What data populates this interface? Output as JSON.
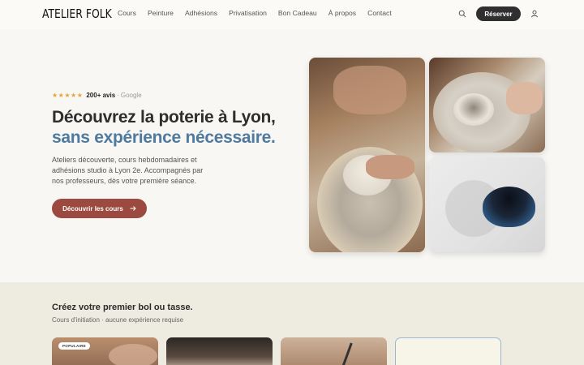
{
  "header": {
    "logo": "ATELIER FOLK",
    "nav": [
      "Cours",
      "Peinture",
      "Adhésions",
      "Privatisation",
      "Bon Cadeau",
      "À propos",
      "Contact"
    ],
    "reserve_label": "Réserver",
    "icons": {
      "search": "search-icon",
      "user": "user-icon"
    }
  },
  "hero": {
    "stars": "★★★★★",
    "rating_count": "200+ avis",
    "rating_sep": "·",
    "rating_source": "Google",
    "title_line1": "Découvrez la poterie à Lyon,",
    "title_line2": "sans expérience nécessaire.",
    "description": "Ateliers découverte, cours hebdomadaires et adhésions studio à Lyon 2e. Accompagnés par nos professeurs, dès votre première séance.",
    "cta_label": "Découvrir les cours",
    "cta_icon": "arrow-right-icon"
  },
  "section": {
    "title": "Créez votre premier bol ou tasse.",
    "subtitle": "Cours d'initiation · aucune expérience requise",
    "cards": [
      {
        "badge": "POPULAIRE"
      },
      {
        "badge": ""
      },
      {
        "badge": ""
      },
      {
        "badge": ""
      }
    ]
  },
  "colors": {
    "accent_terracotta": "#9c4a3f",
    "accent_blue": "#4e7aa0",
    "dark_button": "#2f2f2f",
    "star": "#e7a43c",
    "section_bg": "#eeece0"
  }
}
